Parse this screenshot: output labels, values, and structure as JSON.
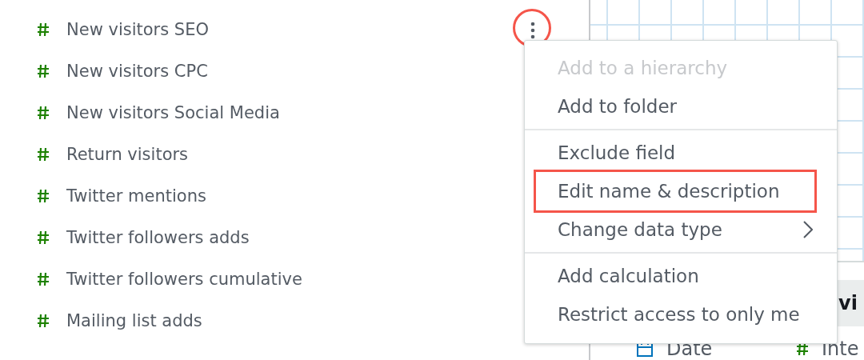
{
  "fields": [
    {
      "name": "New visitors SEO",
      "menu_button": true,
      "circled": true
    },
    {
      "name": "New visitors CPC",
      "menu_button": false,
      "circled": false
    },
    {
      "name": "New visitors Social Media",
      "menu_button": false,
      "circled": false
    },
    {
      "name": "Return visitors",
      "menu_button": false,
      "circled": false
    },
    {
      "name": "Twitter mentions",
      "menu_button": false,
      "circled": false
    },
    {
      "name": "Twitter followers adds",
      "menu_button": false,
      "circled": false
    },
    {
      "name": "Twitter followers cumulative",
      "menu_button": false,
      "circled": false
    },
    {
      "name": "Mailing list adds",
      "menu_button": false,
      "circled": false
    }
  ],
  "context_menu": {
    "sections": [
      [
        {
          "label": "Add to a hierarchy",
          "disabled": true,
          "highlighted": false,
          "submenu": false
        },
        {
          "label": "Add to folder",
          "disabled": false,
          "highlighted": false,
          "submenu": false
        }
      ],
      [
        {
          "label": "Exclude field",
          "disabled": false,
          "highlighted": false,
          "submenu": false
        },
        {
          "label": "Edit name & description",
          "disabled": false,
          "highlighted": true,
          "submenu": false
        },
        {
          "label": "Change data type",
          "disabled": false,
          "highlighted": false,
          "submenu": true
        }
      ],
      [
        {
          "label": "Add calculation",
          "disabled": false,
          "highlighted": false,
          "submenu": false
        },
        {
          "label": "Restrict access to only me",
          "disabled": false,
          "highlighted": false,
          "submenu": false
        }
      ]
    ]
  },
  "visual": {
    "title": "vi",
    "columns": [
      {
        "kind": "date",
        "label": "Date"
      },
      {
        "kind": "measure",
        "label": "Inte"
      }
    ]
  }
}
